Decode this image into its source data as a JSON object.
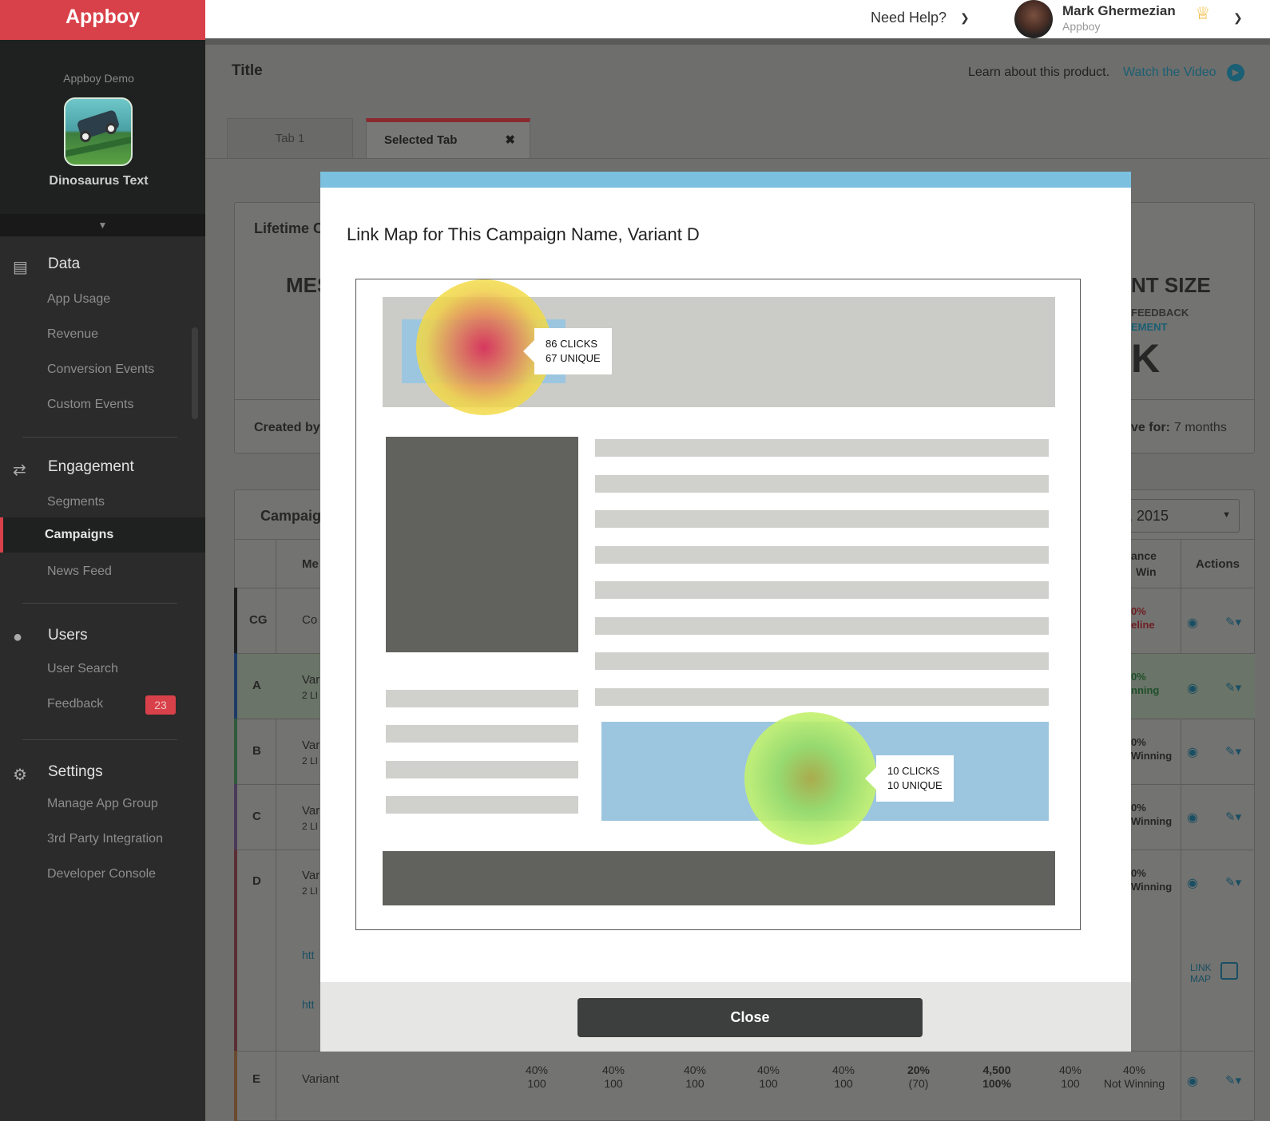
{
  "topbar": {
    "logo": "Appboy",
    "help": "Need Help?",
    "user_name": "Mark Ghermezian",
    "user_org": "Appboy"
  },
  "sidebar": {
    "app_group": "Appboy Demo",
    "app_name": "Dinosaurus Text",
    "sections": {
      "data": {
        "label": "Data",
        "items": [
          "App Usage",
          "Revenue",
          "Conversion Events",
          "Custom Events"
        ]
      },
      "engagement": {
        "label": "Engagement",
        "items": [
          "Segments",
          "Campaigns",
          "News Feed"
        ]
      },
      "users": {
        "label": "Users",
        "items": [
          "User Search",
          "Feedback"
        ],
        "feedback_badge": "23"
      },
      "settings": {
        "label": "Settings",
        "items": [
          "Manage App Group",
          "3rd Party Integration",
          "Developer Console"
        ]
      }
    }
  },
  "page": {
    "title": "Title",
    "learn": "Learn about this product.",
    "watch": "Watch the Video",
    "tabs": [
      "Tab 1",
      "Selected Tab"
    ],
    "lifetime_label": "Lifetime C",
    "mes": "MES",
    "nt_size": "NT SIZE",
    "feedback_small": "FEEDBACK",
    "ement_small": "EMENT",
    "big_k": "K",
    "created_by": "Created by",
    "active_for_label": "ve for:",
    "active_for_value": "7 months",
    "campaign_label": "Campaig",
    "date_suffix": ", 2015",
    "col_me": "Me",
    "col_chance": "ance",
    "col_win": "Win",
    "col_actions": "Actions",
    "rows": [
      {
        "key": "CG",
        "text": "Co",
        "sub": "",
        "pct": "0%",
        "status": "eline"
      },
      {
        "key": "A",
        "text": "Var",
        "sub": "2 LI",
        "pct": "0%",
        "status": "nning"
      },
      {
        "key": "B",
        "text": "Var",
        "sub": "2 LI",
        "pct": "0%",
        "status": "Winning"
      },
      {
        "key": "C",
        "text": "Var",
        "sub": "2 LI",
        "pct": "0%",
        "status": "Winning"
      },
      {
        "key": "D",
        "text": "Var",
        "sub": "2 LI",
        "pct": "0%",
        "status": "Winning"
      }
    ],
    "link_rows": [
      "htt",
      "htt"
    ],
    "link_map": "LINK MAP",
    "row_e": {
      "key": "E",
      "name": "Variant",
      "cells": [
        {
          "a": "40%",
          "b": "100"
        },
        {
          "a": "40%",
          "b": "100"
        },
        {
          "a": "40%",
          "b": "100"
        },
        {
          "a": "40%",
          "b": "100"
        },
        {
          "a": "40%",
          "b": "100"
        },
        {
          "a": "20%",
          "b": "(70)"
        },
        {
          "a": "4,500",
          "b": "100%"
        },
        {
          "a": "40%",
          "b": "100"
        },
        {
          "a": "40%",
          "b": "Not Winning"
        }
      ]
    }
  },
  "modal": {
    "title": "Link Map for This Campaign Name, Variant D",
    "hotspots": [
      {
        "clicks": "86 CLICKS",
        "unique": "67 UNIQUE"
      },
      {
        "clicks": "10 CLICKS",
        "unique": "10 UNIQUE"
      }
    ],
    "close": "Close"
  },
  "colors": {
    "brand_red": "#d9414a",
    "modal_accent": "#7bc0df",
    "link_blue": "#1a5f73"
  }
}
